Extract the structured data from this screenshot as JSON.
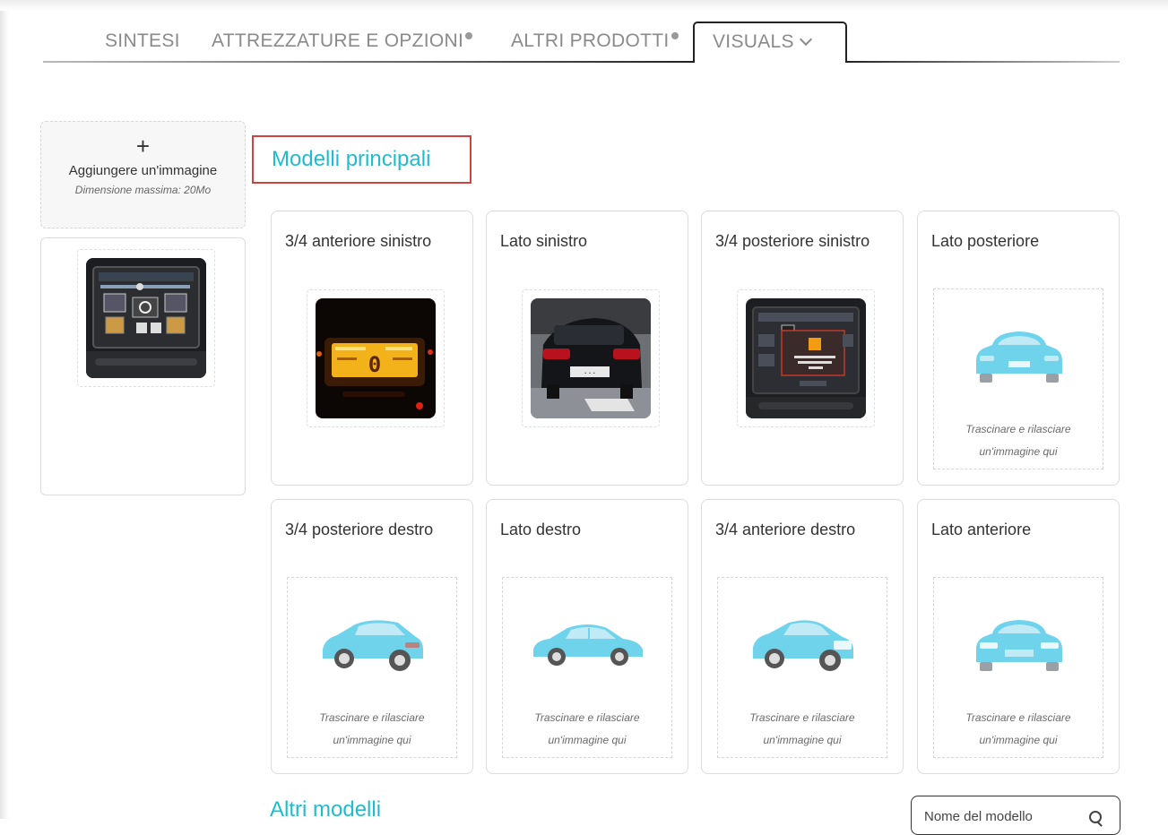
{
  "tabs": {
    "sintesi": "SINTESI",
    "attrezzature": "ATTREZZATURE E OPZIONI",
    "altri_prodotti": "ALTRI PRODOTTI",
    "visuals": "VISUALS"
  },
  "sidebar": {
    "upload_plus": "+",
    "upload_label": "Aggiungere un'immagine",
    "upload_hint": "Dimensione massima: 20Mo"
  },
  "main": {
    "section_title": "Modelli principali",
    "other_title": "Altri modelli",
    "search_placeholder": "Nome del modello",
    "drop_line1": "Trascinare e rilasciare",
    "drop_line2": "un'immagine qui",
    "cards": [
      {
        "title": "3/4 anteriore sinistro"
      },
      {
        "title": "Lato sinistro"
      },
      {
        "title": "3/4 posteriore sinistro"
      },
      {
        "title": "Lato posteriore"
      },
      {
        "title": "3/4 posteriore destro"
      },
      {
        "title": "Lato destro"
      },
      {
        "title": "3/4 anteriore destro"
      },
      {
        "title": "Lato anteriore"
      }
    ]
  },
  "colors": {
    "accent": "#1fbcd0",
    "highlight_border": "#d0443f",
    "car_placeholder": "#6fd3ec"
  }
}
